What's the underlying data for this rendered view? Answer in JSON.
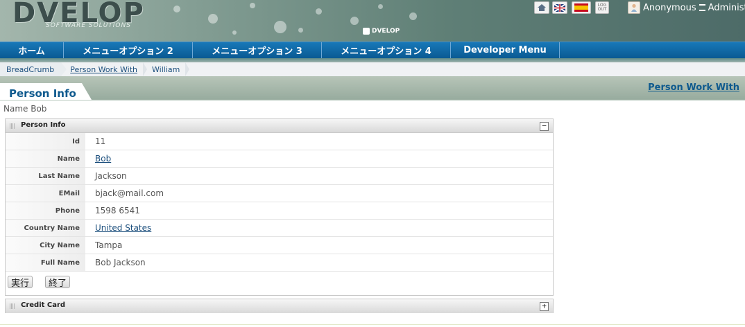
{
  "header": {
    "logo_text": "DVELOP",
    "logo_tagline": "SOFTWARE SOLUTIONS",
    "brand_small": "DVELOP",
    "logout_label": "LOG OUT",
    "user_name": "Anonymous",
    "user_role": "Administ"
  },
  "menu": {
    "items": [
      {
        "label": "ホーム"
      },
      {
        "label": "メニューオプション 2"
      },
      {
        "label": "メニューオプション 3"
      },
      {
        "label": "メニューオプション 4"
      },
      {
        "label": "Developer Menu"
      }
    ]
  },
  "breadcrumb": {
    "items": [
      "BreadCrumb",
      "Person Work With",
      "William"
    ]
  },
  "page": {
    "title": "Person Info",
    "right_link": "Person Work With",
    "subtitle": "Name Bob"
  },
  "person_panel": {
    "title": "Person Info",
    "toggle": "−",
    "fields": [
      {
        "label": "Id",
        "value": "11"
      },
      {
        "label": "Name",
        "value": "Bob"
      },
      {
        "label": "Last Name",
        "value": "Jackson"
      },
      {
        "label": "EMail",
        "value": "bjack@mail.com"
      },
      {
        "label": "Phone",
        "value": "1598 6541"
      },
      {
        "label": "Country Name",
        "value": "United States"
      },
      {
        "label": "City Name",
        "value": "Tampa"
      },
      {
        "label": "Full Name",
        "value": "Bob Jackson"
      }
    ],
    "buttons": {
      "run": "実行",
      "close": "終了"
    }
  },
  "credit_panel": {
    "title": "Credit Card",
    "toggle": "+"
  },
  "colors": {
    "menu_blue": "#0a5a93",
    "title_blue": "#0f5a8e",
    "link_blue": "#1c4f7d"
  }
}
